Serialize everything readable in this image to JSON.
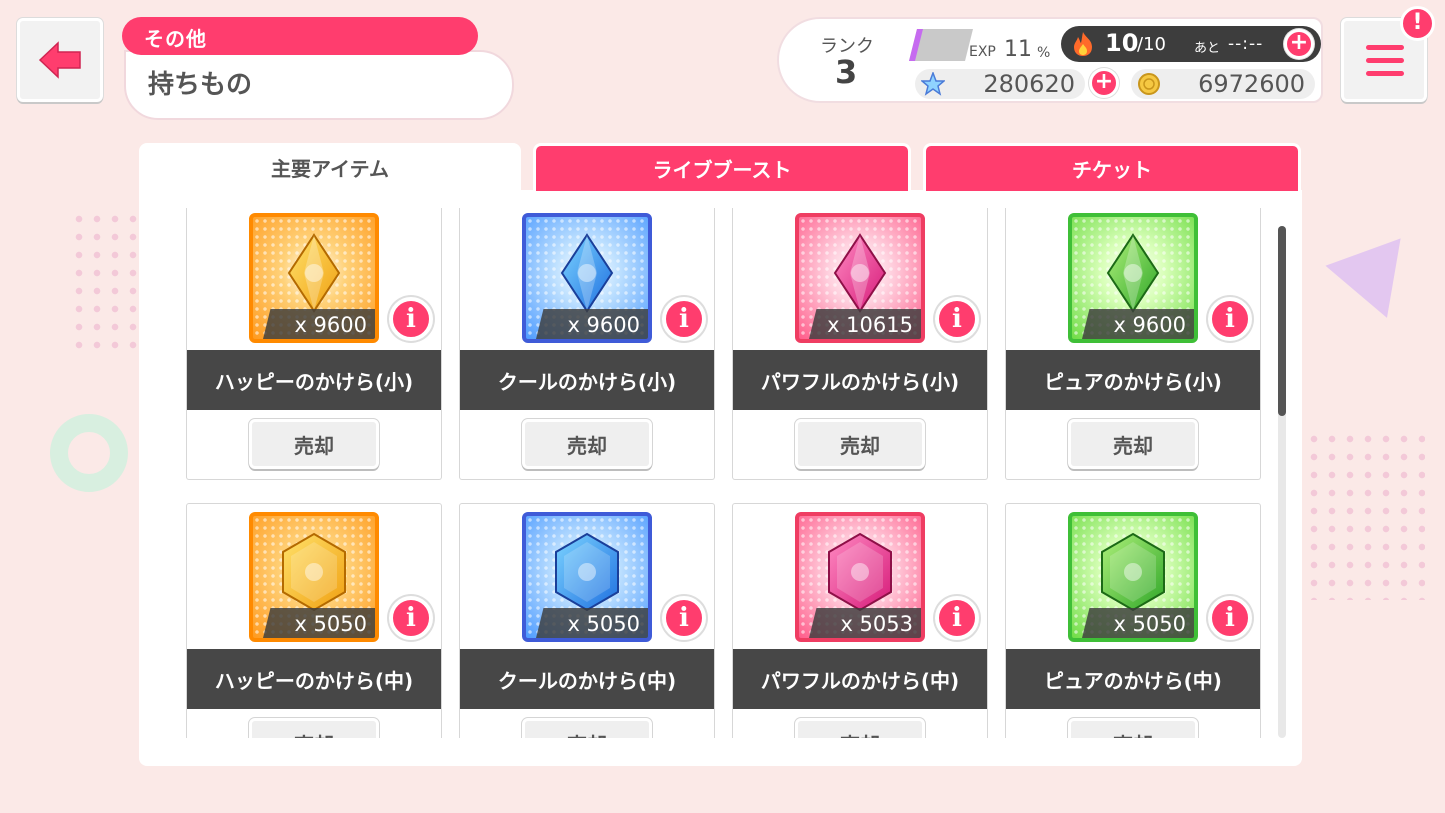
{
  "header": {
    "category": "その他",
    "title": "持ちもの"
  },
  "status": {
    "rank_label": "ランク",
    "rank": "3",
    "exp_label": "EXP",
    "exp_value": "11",
    "exp_unit": "%",
    "exp_progress_percent": 11,
    "stamina_current": "10",
    "stamina_max": "/10",
    "stamina_ato": "あと",
    "stamina_timer": "--:--",
    "star_gems": "280620",
    "coins": "6972600"
  },
  "tabs": [
    {
      "label": "主要アイテム",
      "active": true
    },
    {
      "label": "ライブブースト",
      "active": false
    },
    {
      "label": "チケット",
      "active": false
    }
  ],
  "items": [
    {
      "name": "ハッピーのかけら(小)",
      "qty": "x 9600",
      "type": "happy",
      "size": "small",
      "sell": "売却"
    },
    {
      "name": "クールのかけら(小)",
      "qty": "x 9600",
      "type": "cool",
      "size": "small",
      "sell": "売却"
    },
    {
      "name": "パワフルのかけら(小)",
      "qty": "x 10615",
      "type": "powerful",
      "size": "small",
      "sell": "売却"
    },
    {
      "name": "ピュアのかけら(小)",
      "qty": "x 9600",
      "type": "pure",
      "size": "small",
      "sell": "売却"
    },
    {
      "name": "ハッピーのかけら(中)",
      "qty": "x 5050",
      "type": "happy",
      "size": "medium",
      "sell": "売却"
    },
    {
      "name": "クールのかけら(中)",
      "qty": "x 5050",
      "type": "cool",
      "size": "medium",
      "sell": "売却"
    },
    {
      "name": "パワフルのかけら(中)",
      "qty": "x 5053",
      "type": "powerful",
      "size": "medium",
      "sell": "売却"
    },
    {
      "name": "ピュアのかけら(中)",
      "qty": "x 5050",
      "type": "pure",
      "size": "medium",
      "sell": "売却"
    }
  ],
  "colors": {
    "accent": "#ff3d6e",
    "happy": "#ff8a00",
    "cool": "#3f5bd8",
    "powerful": "#ef3d62",
    "pure": "#3fbf37"
  }
}
